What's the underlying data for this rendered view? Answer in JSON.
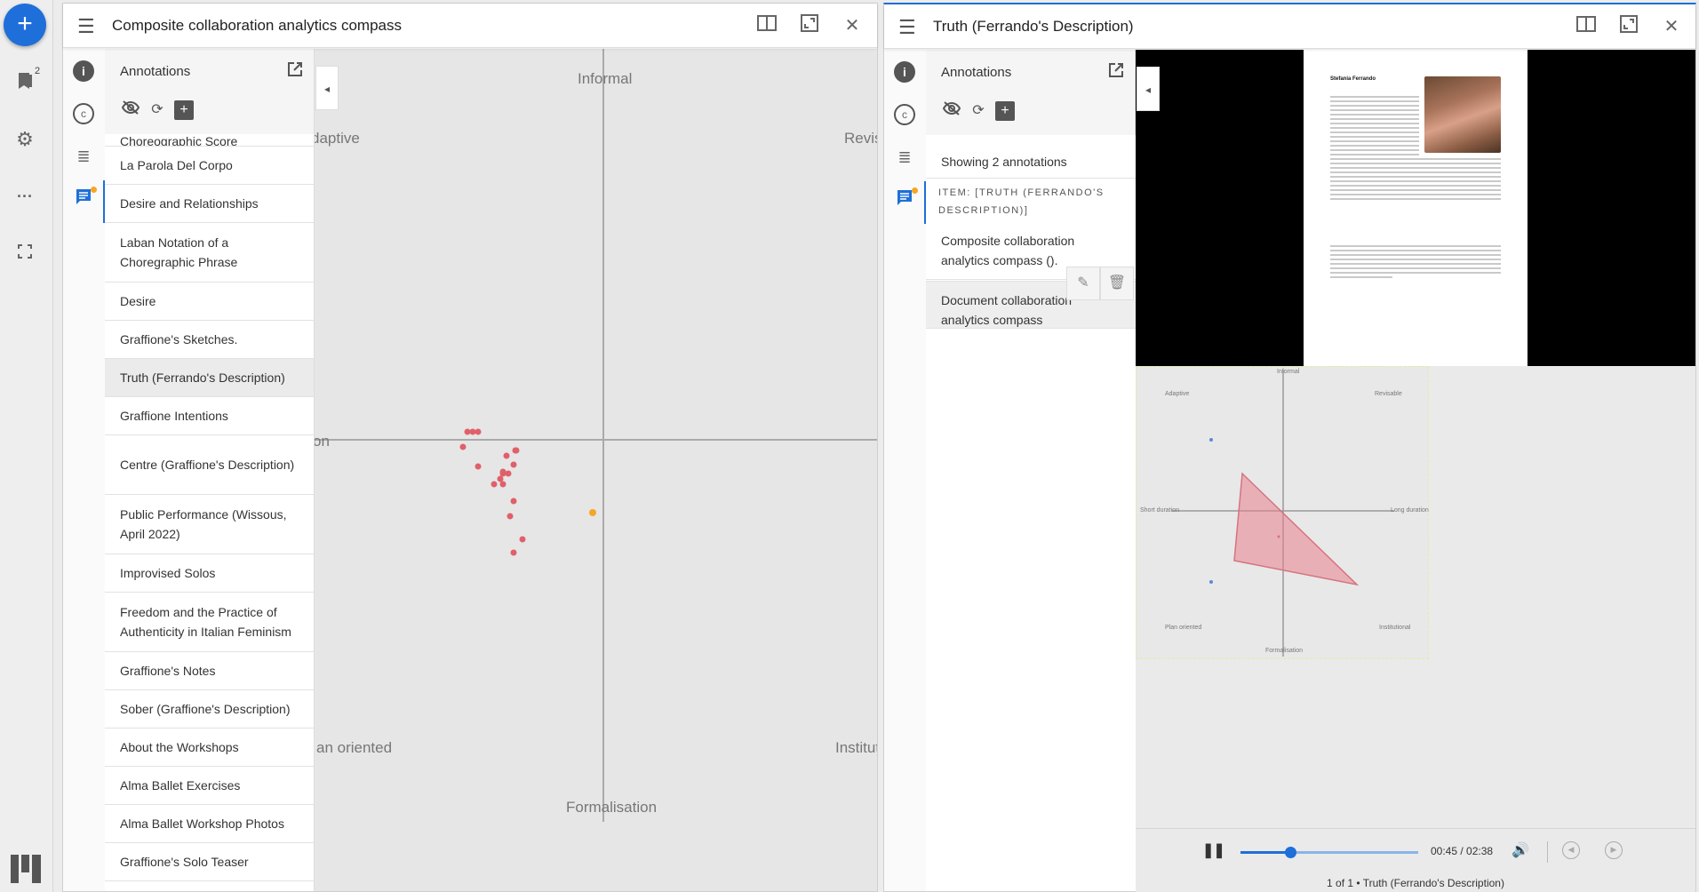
{
  "rail": {
    "add_label": "+",
    "bookmarks_count": "2"
  },
  "left_window": {
    "title": "Composite collaboration analytics compass",
    "annotations_label": "Annotations",
    "list": [
      "Choreographic Score",
      "La Parola Del Corpo",
      "Desire and Relationships",
      "Laban Notation of a Choregraphic Phrase",
      "Desire",
      "Graffione's Sketches.",
      "Truth (Ferrando's Description)",
      "Graffione Intentions",
      "Centre (Graffione's Description)",
      "Public Performance (Wissous, April 2022)",
      "Improvised Solos",
      "Freedom and the Practice of Authenticity in Italian Feminism",
      "Graffione's Notes",
      "Sober (Graffione's Description)",
      "About the Workshops",
      "Alma Ballet Exercises",
      "Alma Ballet Workshop Photos",
      "Graffione's Solo Teaser"
    ],
    "selected_index": 6,
    "compass": {
      "top": "Informal",
      "bottom": "Formalisation",
      "top_left": "daptive",
      "top_right": "Revis",
      "left": "on",
      "bottom_left": "an oriented",
      "bottom_right": "Institut"
    }
  },
  "right_window": {
    "title": "Truth (Ferrando's Description)",
    "annotations_label": "Annotations",
    "showing": "Showing 2 annotations",
    "item_header": "ITEM: [TRUTH (FERRANDO'S DESCRIPTION)]",
    "annotations": [
      "Composite collaboration analytics compass ().",
      "Document collaboration analytics compass"
    ],
    "doc_author": "Stefania Ferrando",
    "overlay_compass": {
      "top": "Informal",
      "bottom": "Formalisation",
      "top_left": "Adaptive",
      "top_right": "Revisable",
      "left": "Short duration",
      "right": "Long duration",
      "bottom_left": "Plan oriented",
      "bottom_right": "Institutional"
    },
    "player": {
      "time": "00:45 / 02:38",
      "progress": 0.28,
      "caption": "1 of 1 • Truth (Ferrando's Description)"
    }
  },
  "colors": {
    "accent": "#1e6fd9",
    "points": "#e0606a",
    "badge": "#f5a623"
  }
}
